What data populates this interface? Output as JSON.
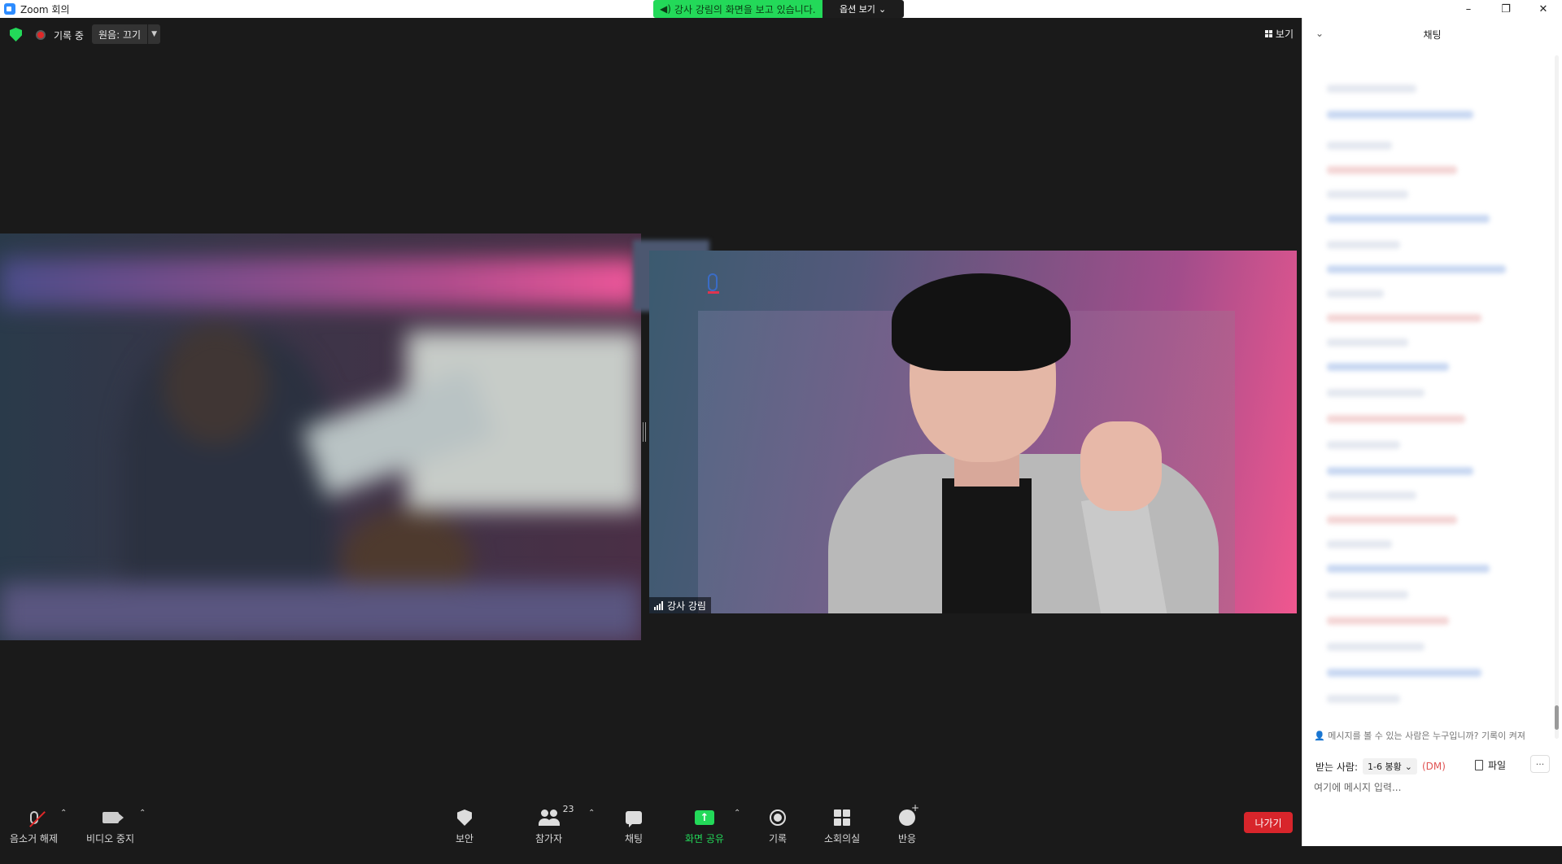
{
  "window": {
    "title": "Zoom 회의",
    "controls": [
      "–",
      "❐",
      "✕"
    ]
  },
  "share_banner": {
    "message": "강사 강림의 화면을 보고 있습니다.",
    "options_label": "옵션 보기"
  },
  "topbar": {
    "recording_label": "기록 중",
    "original_audio_label": "원음: 끄기",
    "view_label": "보기"
  },
  "video": {
    "speaker_name": "강사 강림"
  },
  "toolbar": {
    "unmute_label": "음소거 해제",
    "stop_video_label": "비디오 중지",
    "security_label": "보안",
    "participants_label": "참가자",
    "participants_count": "23",
    "chat_label": "채팅",
    "share_screen_label": "화면 공유",
    "record_label": "기록",
    "breakout_label": "소회의실",
    "reactions_label": "반응",
    "leave_label": "나가기"
  },
  "chat": {
    "title": "채팅",
    "privacy_note": "메시지를 볼 수 있는 사람은 누구입니까? 기록이 켜져",
    "to_label": "받는 사람:",
    "to_value": "1-6 봉황",
    "dm_label": "(DM)",
    "file_label": "파일",
    "more_label": "···",
    "input_placeholder": "여기에 메시지 입력..."
  },
  "colors": {
    "accent_green": "#23d959",
    "leave_red": "#d8252b",
    "mute_red": "#e02828"
  }
}
